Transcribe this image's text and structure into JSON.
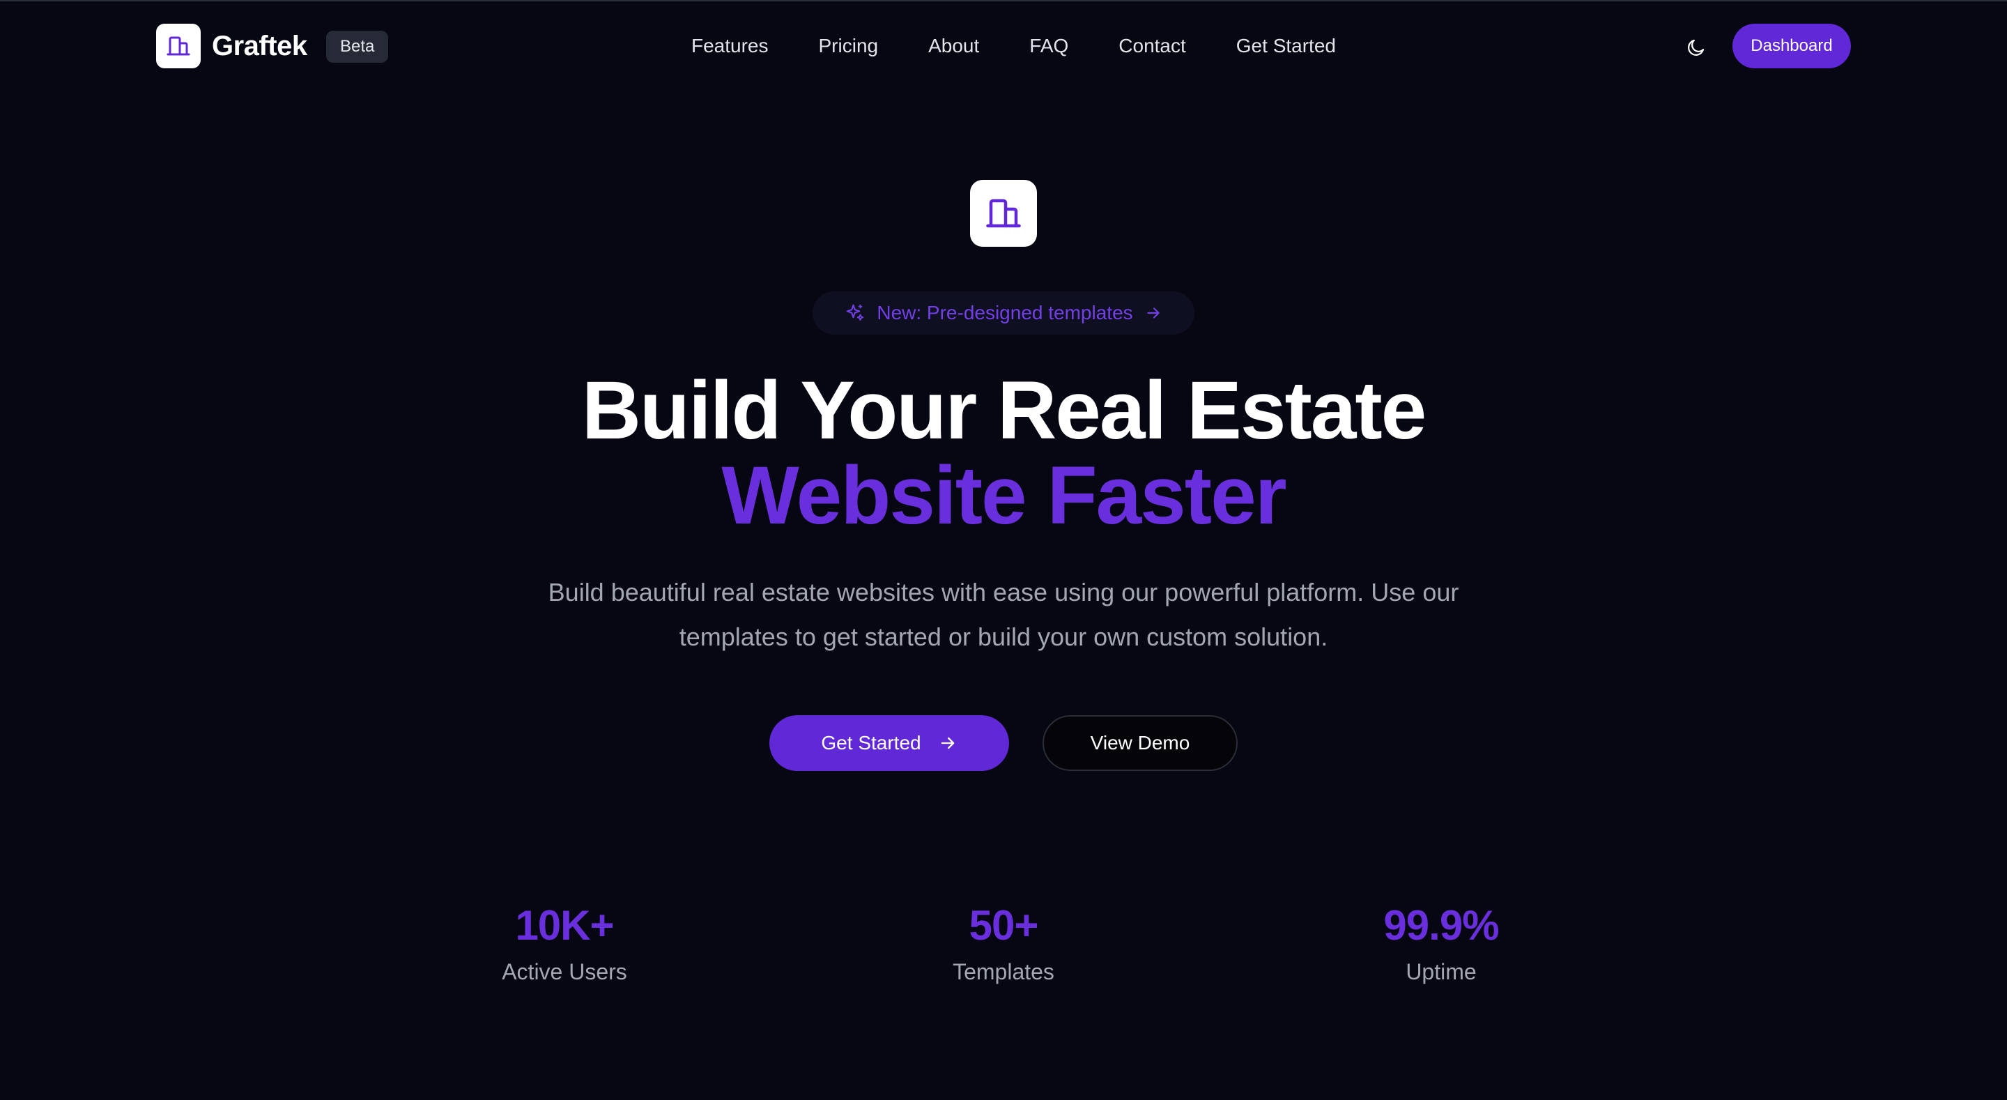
{
  "header": {
    "brand": "Graftek",
    "badge": "Beta",
    "nav": [
      "Features",
      "Pricing",
      "About",
      "FAQ",
      "Contact",
      "Get Started"
    ],
    "theme_toggle_icon": "moon-icon",
    "dashboard_label": "Dashboard"
  },
  "hero": {
    "icon": "building-icon",
    "pill_label": "New: Pre-designed templates",
    "headline_line1": "Build Your Real Estate",
    "headline_line2": "Website Faster",
    "subtext": "Build beautiful real estate websites with ease using our powerful platform. Use our templates to get started or build your own custom solution.",
    "primary_cta": "Get Started",
    "secondary_cta": "View Demo"
  },
  "stats": [
    {
      "value": "10K+",
      "label": "Active Users"
    },
    {
      "value": "50+",
      "label": "Templates"
    },
    {
      "value": "99.9%",
      "label": "Uptime"
    }
  ],
  "colors": {
    "background": "#060713",
    "accent": "#6028d6",
    "accent_text": "#6a2fdc",
    "muted_text": "#a3a6b3"
  }
}
